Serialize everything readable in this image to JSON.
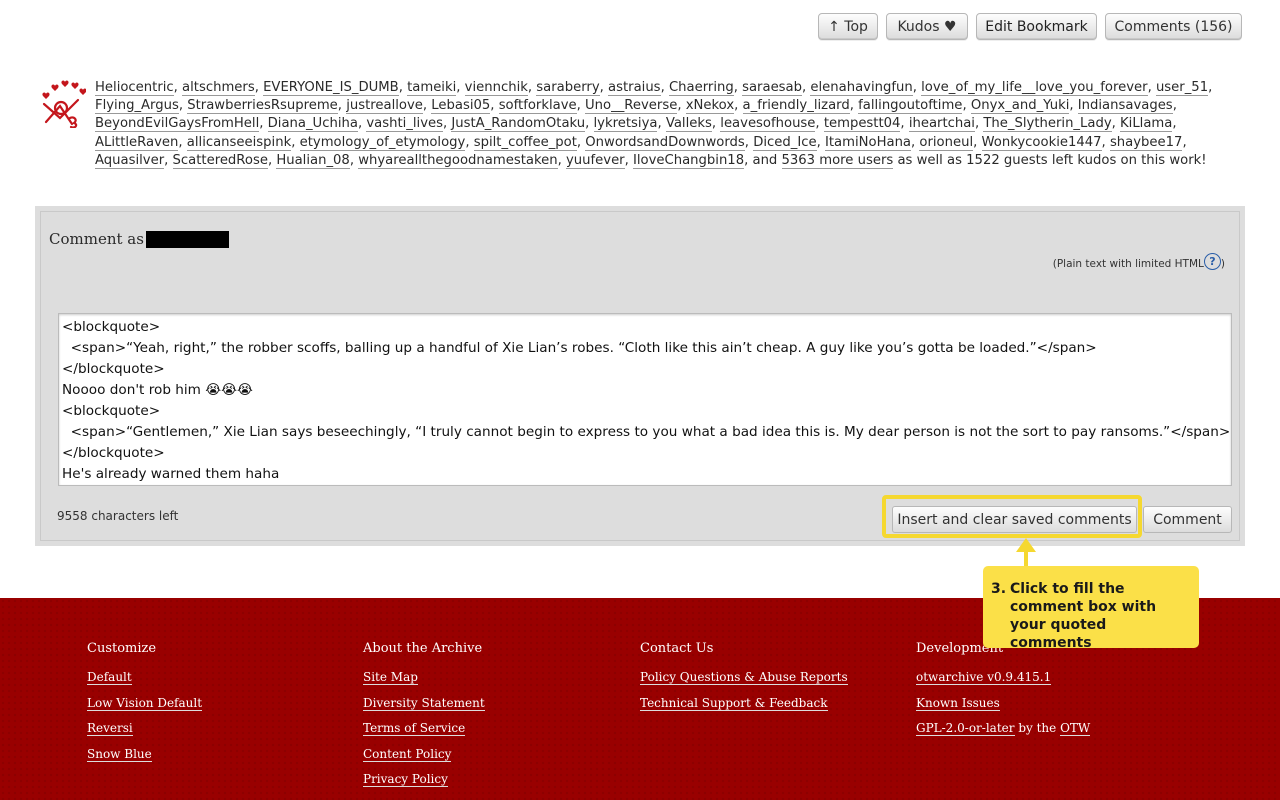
{
  "actions": {
    "top": "↑ Top",
    "kudos": "Kudos ♥",
    "edit_bookmark": "Edit Bookmark",
    "comments": "Comments (156)"
  },
  "kudos": {
    "users": [
      "Heliocentric",
      "altschmers",
      "EVERYONE_IS_DUMB",
      "tameiki",
      "viennchik",
      "saraberry",
      "astraius",
      "Chaerring",
      "saraesab",
      "elenahavingfun",
      "love_of_my_life__love_you_forever",
      "user_51",
      "Flying_Argus",
      "StrawberriesRsupreme",
      "justreallove",
      "Lebasi05",
      "softforklave",
      "Uno__Reverse",
      "xNekox",
      "a_friendly_lizard",
      "fallingoutoftime",
      "Onyx_and_Yuki",
      "Indiansavages",
      "BeyondEvilGaysFromHell",
      "Diana_Uchiha",
      "vashti_lives",
      "JustA_RandomOtaku",
      "lykretsiya",
      "Valleks",
      "leavesofhouse",
      "tempestt04",
      "iheartchai",
      "The_Slytherin_Lady",
      "KiLlama",
      "ALittleRaven",
      "allicanseeispink",
      "etymology_of_etymology",
      "spilt_coffee_pot",
      "OnwordsandDownwords",
      "Diced_Ice",
      "ItamiNoHana",
      "orioneul",
      "Wonkycookie1447",
      "shaybee17",
      "Aquasilver",
      "ScatteredRose",
      "Hualian_08",
      "whyareallthegoodnamestaken",
      "yuufever",
      "IloveChangbin18"
    ],
    "and_text": "and",
    "more_users": "5363 more users",
    "guests_text": "as well as 1522 guests left kudos on this work!"
  },
  "comment_form": {
    "comment_as": "Comment as",
    "plain_text_note": "(Plain text with limited HTML",
    "help_symbol": "?",
    "plain_text_close": ")",
    "textarea_lines": [
      "<blockquote>",
      "  <span>“Yeah, right,” the robber scoffs, balling up a handful of Xie Lian’s robes. “Cloth like this ain’t cheap. A guy like you’s gotta be loaded.”</span>",
      "</blockquote>",
      "Noooo don't rob him 😭😭😭",
      "<blockquote>",
      "  <span>“Gentlemen,” Xie Lian says beseechingly, “I truly cannot begin to express to you what a bad idea this is. My dear person is not the sort to pay ransoms.”</span>",
      "</blockquote>",
      "He's already warned them haha"
    ],
    "chars_left": "9558 characters left",
    "insert_button": "Insert and clear saved comments",
    "comment_button": "Comment"
  },
  "callout": {
    "number": "3.",
    "text": "Click to fill the comment box with your quoted comments",
    "color": "#fbe048"
  },
  "footer": {
    "columns": [
      {
        "title": "Customize",
        "links": [
          "Default",
          "Low Vision Default",
          "Reversi",
          "Snow Blue"
        ]
      },
      {
        "title": "About the Archive",
        "links": [
          "Site Map",
          "Diversity Statement",
          "Terms of Service",
          "Content Policy",
          "Privacy Policy"
        ]
      },
      {
        "title": "Contact Us",
        "links": [
          "Policy Questions & Abuse Reports",
          "Technical Support & Feedback"
        ]
      },
      {
        "title": "Development",
        "links": [
          "otwarchive v0.9.415.1",
          "Known Issues",
          "GPL-2.0-or-later",
          "OTW"
        ],
        "license_by": "by the"
      }
    ],
    "background": "#990000"
  }
}
